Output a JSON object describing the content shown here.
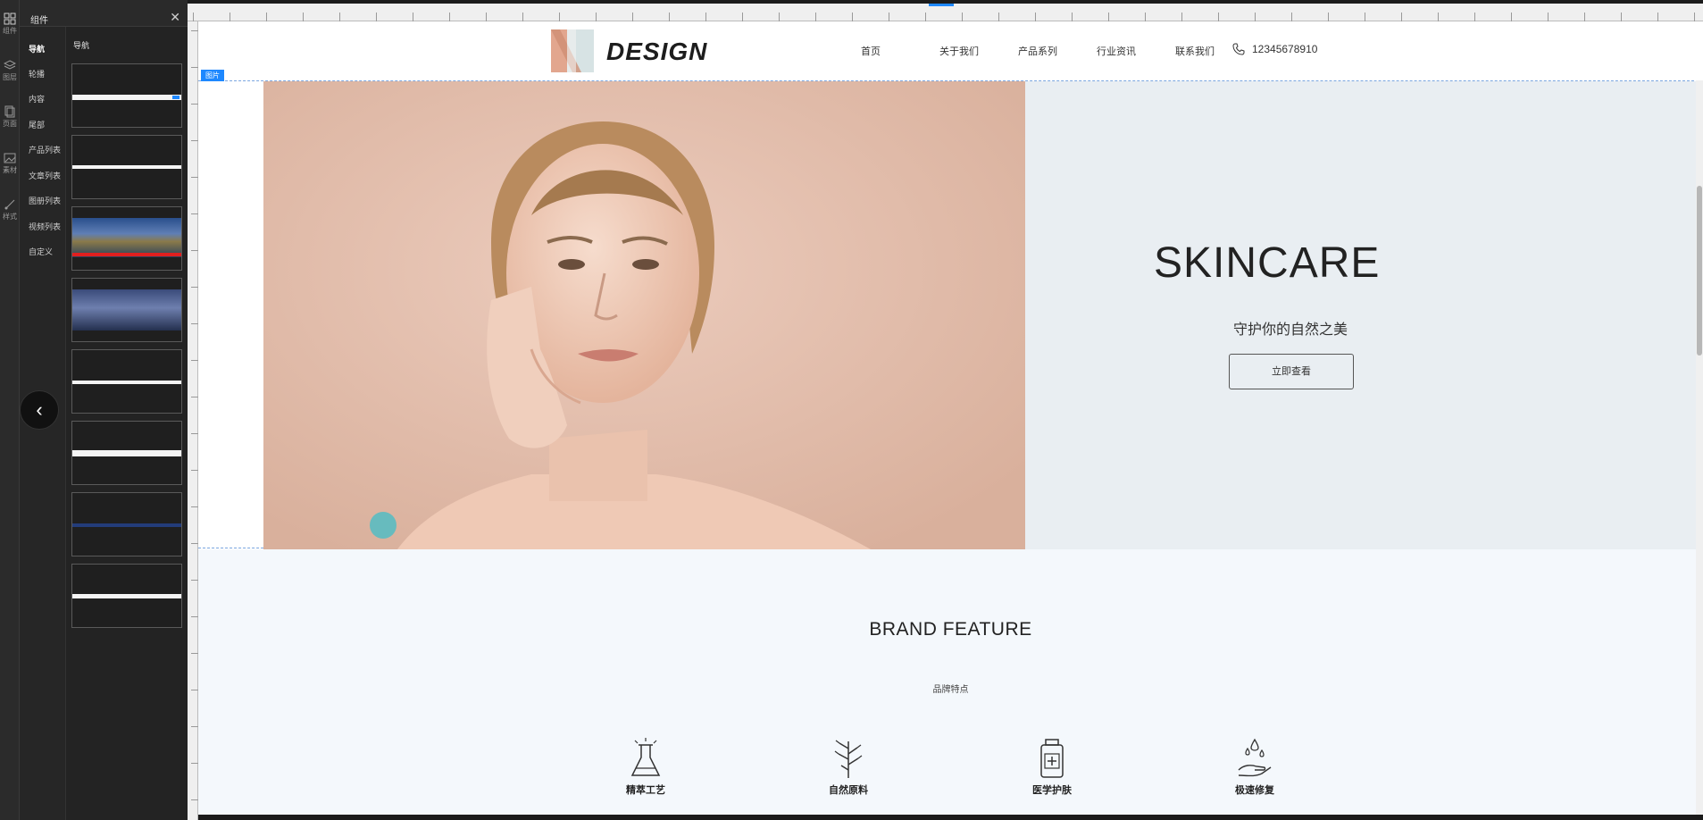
{
  "editor": {
    "panel_title": "组件",
    "close_glyph": "✕",
    "thumbs_label": "导航",
    "collapse_glyph": "‹",
    "rail": [
      {
        "label": "组件",
        "icon": "grid-icon"
      },
      {
        "label": "图层",
        "icon": "layers-icon"
      },
      {
        "label": "页面",
        "icon": "pages-icon"
      },
      {
        "label": "素材",
        "icon": "image-icon"
      },
      {
        "label": "样式",
        "icon": "brush-icon"
      }
    ],
    "categories": [
      "导航",
      "轮播",
      "内容",
      "尾部",
      "产品列表",
      "文章列表",
      "图册列表",
      "视频列表",
      "自定义"
    ],
    "active_category": "导航",
    "section_badge": "图片"
  },
  "site": {
    "logo": "DESIGN",
    "nav": [
      "首页",
      "关于我们",
      "产品系列",
      "行业资讯",
      "联系我们"
    ],
    "phone": "12345678910",
    "hero": {
      "title": "SKINCARE",
      "subtitle": "守护你的自然之美",
      "button": "立即查看"
    },
    "brand": {
      "title": "BRAND FEATURE",
      "subtitle": "品牌特点",
      "features": [
        {
          "label": "精萃工艺",
          "icon": "flask-icon"
        },
        {
          "label": "自然原料",
          "icon": "plant-icon"
        },
        {
          "label": "医学护肤",
          "icon": "medicine-bottle-icon"
        },
        {
          "label": "极速修复",
          "icon": "hand-water-drop-icon"
        }
      ]
    }
  },
  "colors": {
    "accent": "#1e88ff",
    "hero_bg": "#e2bfae",
    "hero_side_bg": "#e9eef2",
    "brand_bg": "#f4f8fc"
  }
}
